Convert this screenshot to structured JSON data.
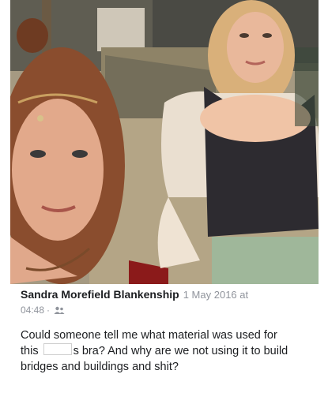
{
  "post": {
    "author": "Sandra Morefield Blankenship",
    "date": "1 May 2016 at",
    "time": "04:48",
    "separator": "·",
    "comment_part1": "Could someone tell me what material was used for this ",
    "comment_part2": "s bra? And why are we not using it to build bridges and buildings and shit?"
  },
  "icons": {
    "audience": "friends-icon"
  },
  "colors": {
    "author": "#1c1e21",
    "meta": "#90949c"
  }
}
